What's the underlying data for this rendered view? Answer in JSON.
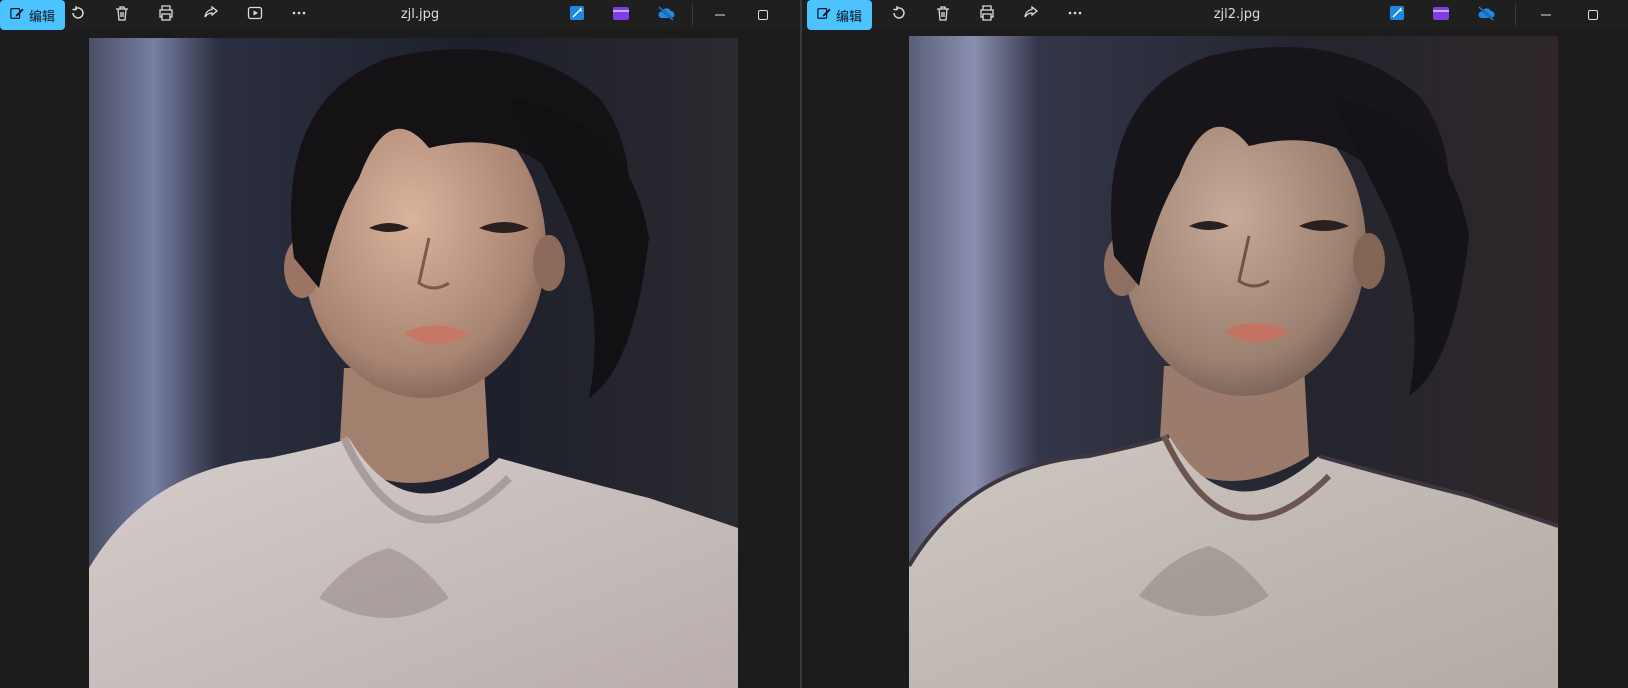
{
  "windows": [
    {
      "title": "zjl.jpg",
      "toolbar": {
        "edit_label": "编辑",
        "icons": [
          "rotate-icon",
          "delete-icon",
          "print-icon",
          "share-icon",
          "slideshow-icon",
          "more-icon"
        ],
        "right_icons": [
          "enhance-icon",
          "clipchamp-icon",
          "onedrive-off-icon"
        ],
        "window_controls": [
          "minimize-icon",
          "maximize-icon"
        ]
      }
    },
    {
      "title": "zjl2.jpg",
      "toolbar": {
        "edit_label": "编辑",
        "icons": [
          "rotate-icon",
          "delete-icon",
          "print-icon",
          "share-icon",
          "more-icon"
        ],
        "right_icons": [
          "enhance-icon",
          "clipchamp-icon",
          "onedrive-off-icon"
        ],
        "window_controls": [
          "minimize-icon",
          "maximize-icon"
        ]
      }
    }
  ],
  "colors": {
    "accent": "#4cc2ff",
    "background": "#1c1c1c",
    "toolbar": "#1f1f1f",
    "shirt": "#c9bfbd",
    "backdrop_blue": "#6a7092"
  }
}
